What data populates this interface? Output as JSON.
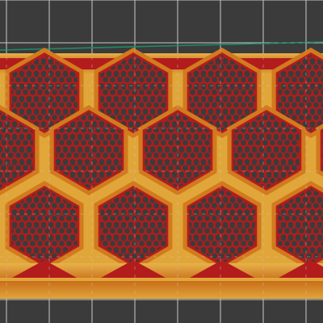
{
  "colors": {
    "background": "#3b3b3b",
    "grid_line": "#c9c9c9",
    "travel_line": "#1f8a6a",
    "perimeter_orange": "#d27a1e",
    "perimeter_gold": "#e0a63a",
    "infill_red": "#b31c1c",
    "infill_dark": "#7a1414"
  },
  "icons": {
    "grid": "bed-grid",
    "part": "sliced-toolpath-preview"
  }
}
